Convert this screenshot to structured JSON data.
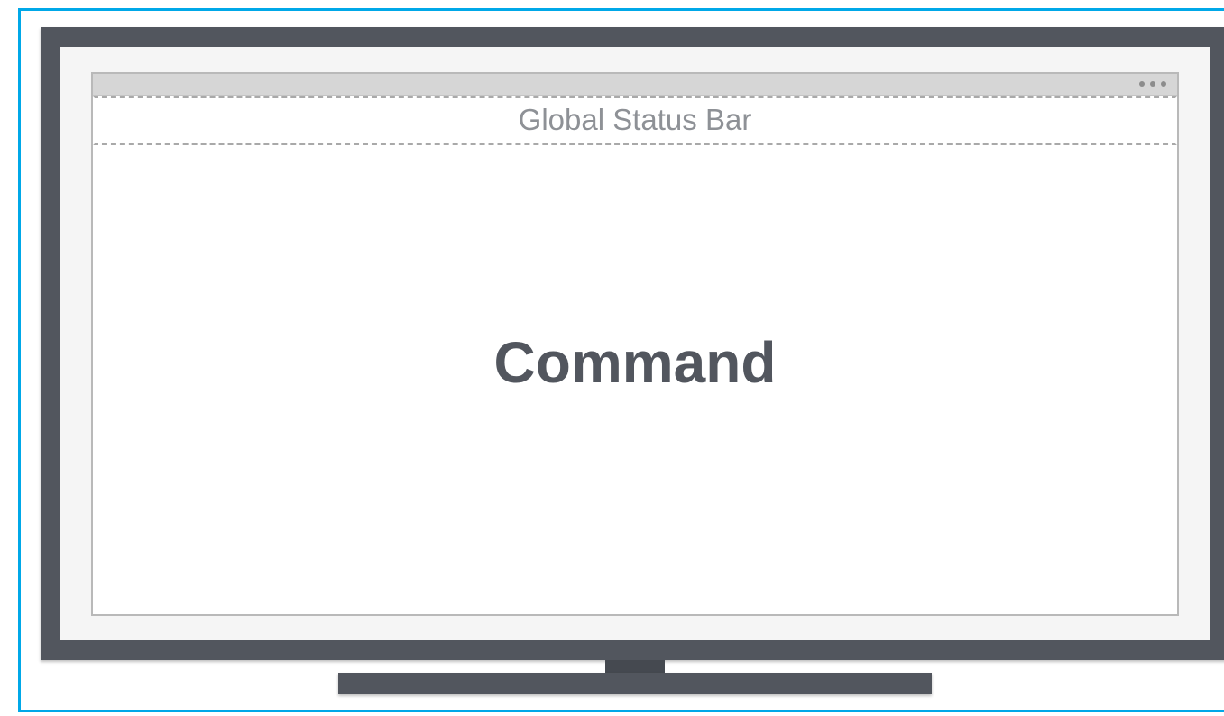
{
  "status_bar": {
    "label": "Global Status Bar"
  },
  "main": {
    "label": "Command"
  },
  "window": {
    "menu_icon": "more-dots-icon"
  },
  "colors": {
    "frame_accent": "#00a8e8",
    "monitor": "#52565e",
    "status_text": "#8e9196"
  }
}
